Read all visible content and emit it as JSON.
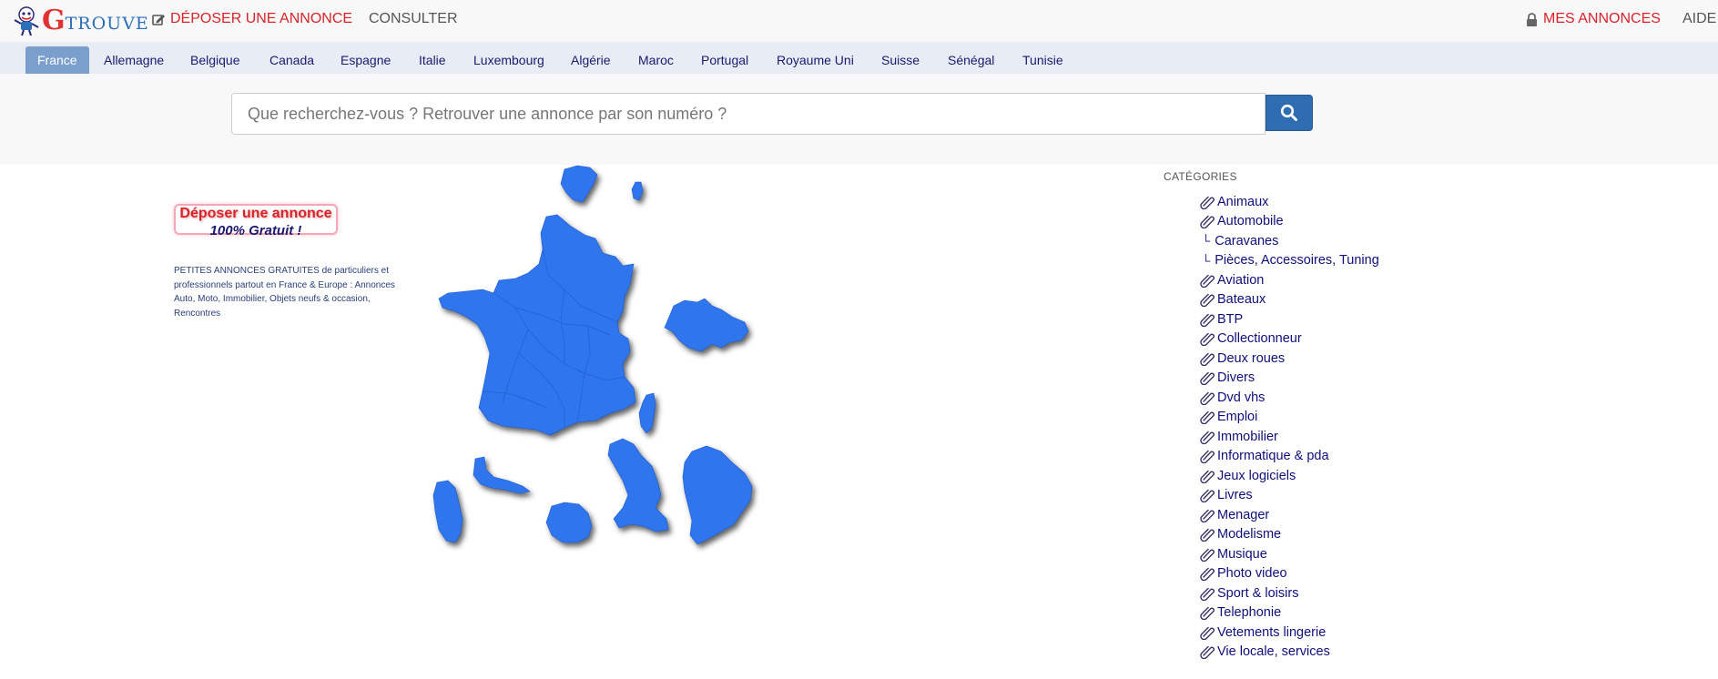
{
  "header": {
    "logo_letter": "G",
    "logo_rest": "TROUVE",
    "deposer_label": "DÉPOSER UNE ANNONCE",
    "consulter_label": "CONSULTER",
    "mes_annonces_label": "MES ANNONCES",
    "aide_label": "AIDE"
  },
  "countries": {
    "items": [
      {
        "label": "France",
        "active": true
      },
      {
        "label": "Allemagne"
      },
      {
        "label": "Belgique"
      },
      {
        "label": "Canada"
      },
      {
        "label": "Espagne"
      },
      {
        "label": "Italie"
      },
      {
        "label": "Luxembourg"
      },
      {
        "label": "Algérie"
      },
      {
        "label": "Maroc"
      },
      {
        "label": "Portugal"
      },
      {
        "label": "Royaume Uni"
      },
      {
        "label": "Suisse"
      },
      {
        "label": "Sénégal"
      },
      {
        "label": "Tunisie"
      }
    ]
  },
  "search": {
    "placeholder": "Que recherchez-vous ? Retrouver une annonce par son numéro ?"
  },
  "promo": {
    "line1": "Déposer une annonce",
    "line2": "100% Gratuit !"
  },
  "description": "PETITES ANNONCES GRATUITES de particuliers et professionnels partout en France & Europe : Annonces Auto, Moto, Immobilier, Objets neufs & occasion, Rencontres",
  "categories": {
    "title": "CATÉGORIES",
    "items": [
      {
        "label": "Animaux"
      },
      {
        "label": "Automobile"
      },
      {
        "label": "Caravanes",
        "sub": true
      },
      {
        "label": "Pièces, Accessoires, Tuning",
        "sub": true
      },
      {
        "label": "Aviation"
      },
      {
        "label": "Bateaux"
      },
      {
        "label": "BTP"
      },
      {
        "label": "Collectionneur"
      },
      {
        "label": "Deux roues"
      },
      {
        "label": "Divers"
      },
      {
        "label": "Dvd vhs"
      },
      {
        "label": "Emploi"
      },
      {
        "label": "Immobilier"
      },
      {
        "label": "Informatique & pda"
      },
      {
        "label": "Jeux logiciels"
      },
      {
        "label": "Livres"
      },
      {
        "label": "Menager"
      },
      {
        "label": "Modelisme"
      },
      {
        "label": "Musique"
      },
      {
        "label": "Photo video"
      },
      {
        "label": "Sport & loisirs"
      },
      {
        "label": "Telephonie"
      },
      {
        "label": "Vetements lingerie"
      },
      {
        "label": "Vie locale, services"
      }
    ]
  },
  "colors": {
    "map_fill": "#2e74ee",
    "accent_red": "#d8232a",
    "link_navy": "#0f0f7a",
    "search_button": "#2f6cb1"
  }
}
